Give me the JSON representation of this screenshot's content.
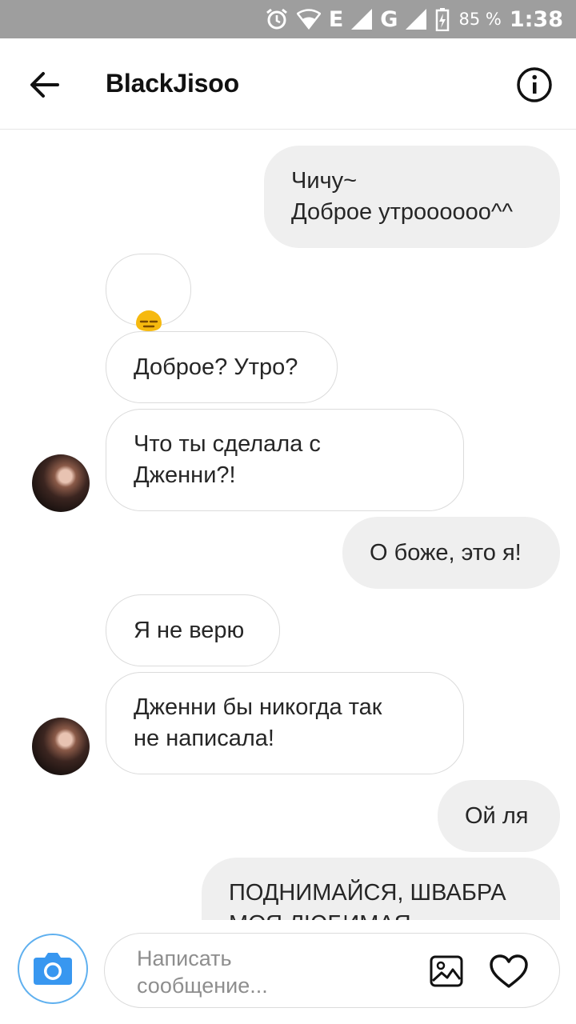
{
  "status_bar": {
    "alarm_icon": "alarm-clock-icon",
    "network_e": "E",
    "network_g": "G",
    "battery_percent": "85 %",
    "time": "1:38"
  },
  "header": {
    "title": "BlackJisoo",
    "back_icon": "arrow-left-icon",
    "info_icon": "info-circle-icon"
  },
  "messages": [
    {
      "side": "out",
      "text": "Чичу~\nДоброе утроооооо^^"
    },
    {
      "side": "in",
      "text": "😑",
      "emoji": true
    },
    {
      "side": "in",
      "text": "Доброе? Утро?"
    },
    {
      "side": "in",
      "text": "Что ты сделала с\nДженни?!"
    },
    {
      "side": "out",
      "text": "О боже, это я!"
    },
    {
      "side": "in",
      "text": "Я не верю"
    },
    {
      "side": "in",
      "text": "Дженни бы никогда так\nне написала!"
    },
    {
      "side": "out",
      "text": "Ой ля"
    },
    {
      "side": "out",
      "text": "ПОДНИМАЙСЯ, ШВАБРА\nМОЯ ЛЮБИМАЯ"
    }
  ],
  "composer": {
    "placeholder": "Написать\nсообщение...",
    "camera_icon": "camera-icon",
    "gallery_icon": "image-icon",
    "like_icon": "heart-icon"
  },
  "colors": {
    "status_bar": "#9e9e9e",
    "outgoing_bubble": "#efefef",
    "incoming_border": "#dbdbdb",
    "camera_accent": "#3897f0"
  }
}
